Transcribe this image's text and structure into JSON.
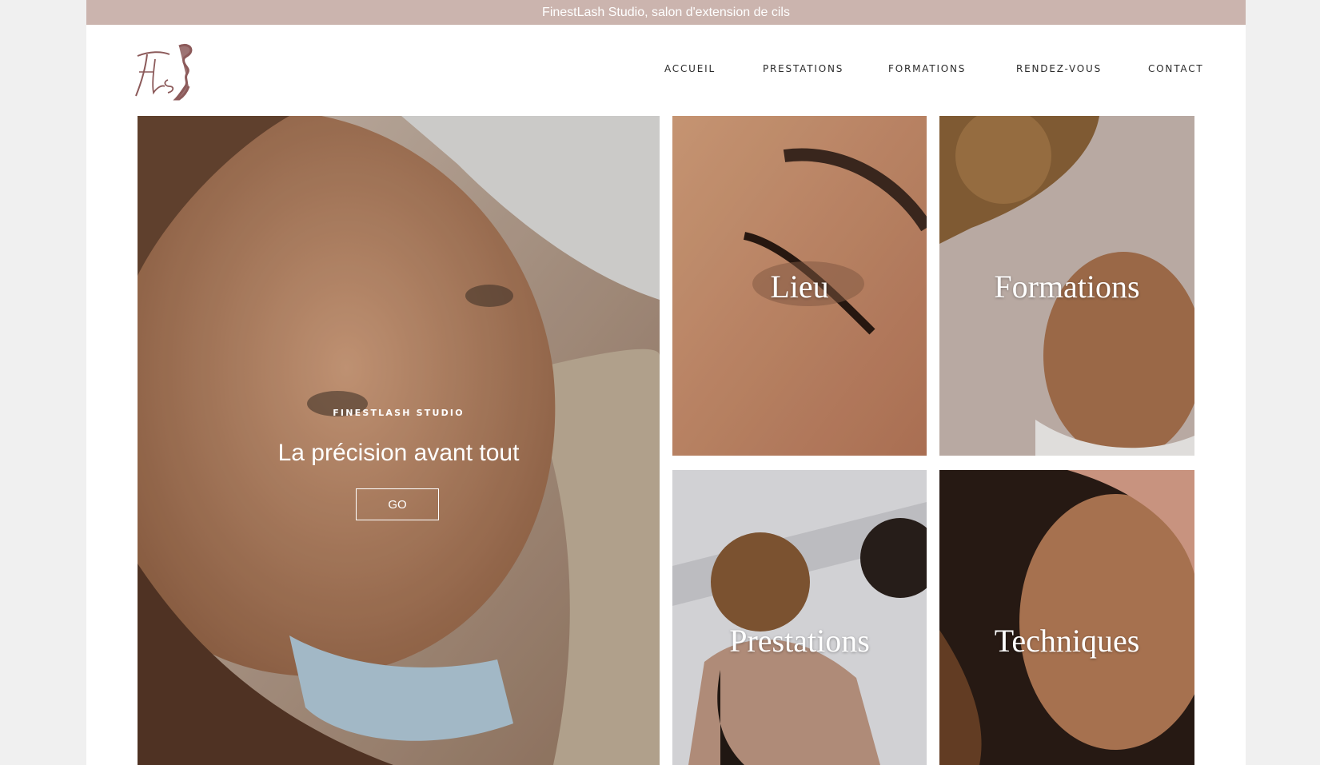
{
  "announcement": "FinestLash Studio, salon d'extension de cils",
  "logo": {
    "icon": "fls-monogram-logo",
    "text": "Fls"
  },
  "nav": {
    "items": [
      {
        "label": "ACCUEIL"
      },
      {
        "label": "PRESTATIONS"
      },
      {
        "label": "FORMATIONS"
      },
      {
        "label": "RENDEZ-VOUS"
      },
      {
        "label": "CONTACT"
      }
    ]
  },
  "hero": {
    "eyebrow": "FINESTLASH STUDIO",
    "title": "La précision avant tout",
    "button_label": "GO"
  },
  "tiles": [
    {
      "label": "Lieu"
    },
    {
      "label": "Formations"
    },
    {
      "label": "Prestations"
    },
    {
      "label": "Techniques"
    }
  ],
  "colors": {
    "announcement_bg": "#cbb4ae",
    "logo": "#8c5a5a",
    "text": "#2b2b2b"
  }
}
